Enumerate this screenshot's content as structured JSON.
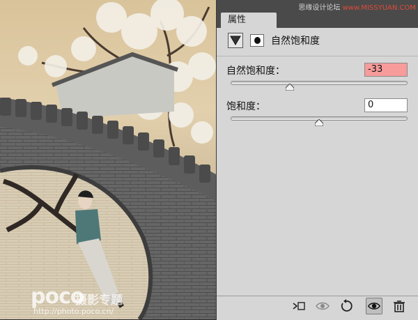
{
  "panel": {
    "tab_label": "属性",
    "adjustment_title": "自然饱和度",
    "vibrance": {
      "label": "自然饱和度：",
      "value": "-33",
      "level_percent": 33.5
    },
    "saturation": {
      "label": "饱和度：",
      "value": "0",
      "level_percent": 50
    }
  },
  "credit": {
    "prefix": "思缘设计论坛",
    "site": "www.MISSYUAN.COM"
  },
  "watermark": {
    "logo": "poco",
    "brand": "摄影专题",
    "url": "http://photo.poco.cn/"
  },
  "icons": [
    "adjustment-layer-icon",
    "layer-mask-icon",
    "clip-to-layer-icon",
    "view-previous-state-icon",
    "reset-icon",
    "visibility-eye-icon",
    "trash-icon"
  ],
  "colors": {
    "highlight_field": "#f79b9b",
    "panel_bg": "#d6d6d6"
  }
}
